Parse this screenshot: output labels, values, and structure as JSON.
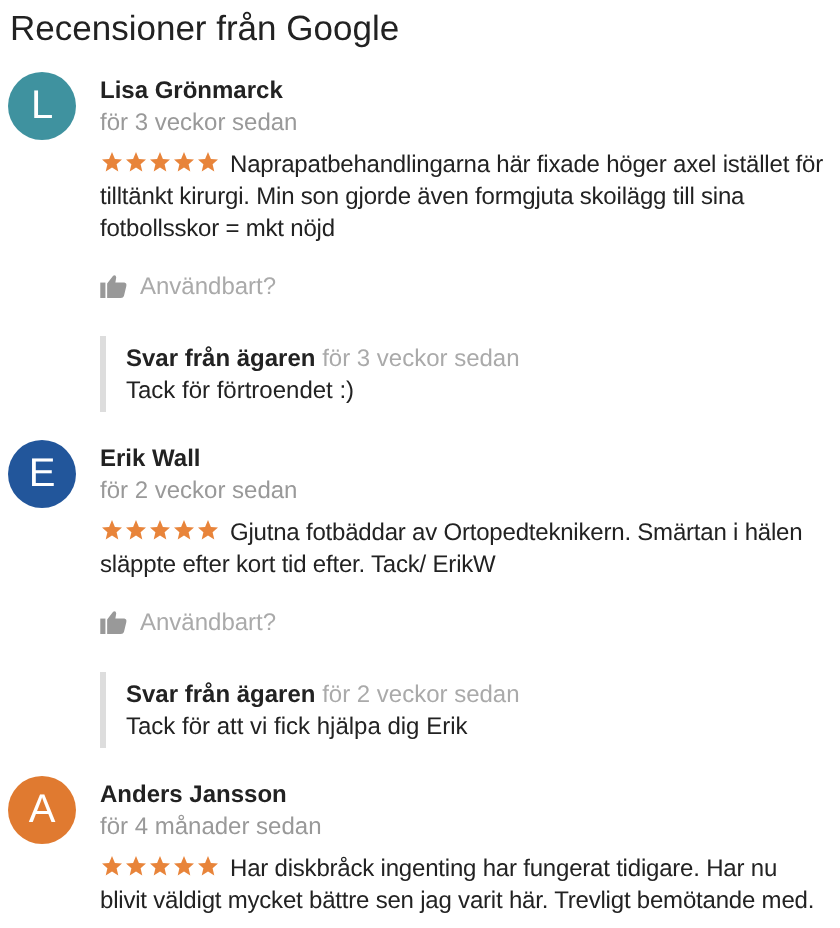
{
  "title": "Recensioner från Google",
  "reviews": [
    {
      "initial": "L",
      "color": "#3f929f",
      "name": "Lisa Grönmarck",
      "time": "för 3 veckor sedan",
      "stars": 5,
      "text": "Naprapatbehandlingarna här fixade höger axel istället för tilltänkt kirurgi. Min son gjorde även formgjuta skoilägg till sina fotbollsskor = mkt nöjd",
      "helpful": "Användbart?",
      "reply": {
        "label": "Svar från ägaren",
        "time": "för 3 veckor sedan",
        "text": "Tack för förtroendet :)"
      }
    },
    {
      "initial": "E",
      "color": "#22569b",
      "name": "Erik Wall",
      "time": "för 2 veckor sedan",
      "stars": 5,
      "text": "Gjutna fotbäddar av Ortopedteknikern. Smärtan i hälen släppte efter kort tid efter. Tack/ ErikW",
      "helpful": "Användbart?",
      "reply": {
        "label": "Svar från ägaren",
        "time": "för 2 veckor sedan",
        "text": "Tack för att vi fick hjälpa dig Erik"
      }
    },
    {
      "initial": "A",
      "color": "#e07a30",
      "name": "Anders Jansson",
      "time": "för 4 månader sedan",
      "stars": 5,
      "text": "Har diskbråck ingenting har fungerat tidigare. Har nu blivit väldigt mycket bättre sen jag varit här. Trevligt bemötande med."
    }
  ]
}
